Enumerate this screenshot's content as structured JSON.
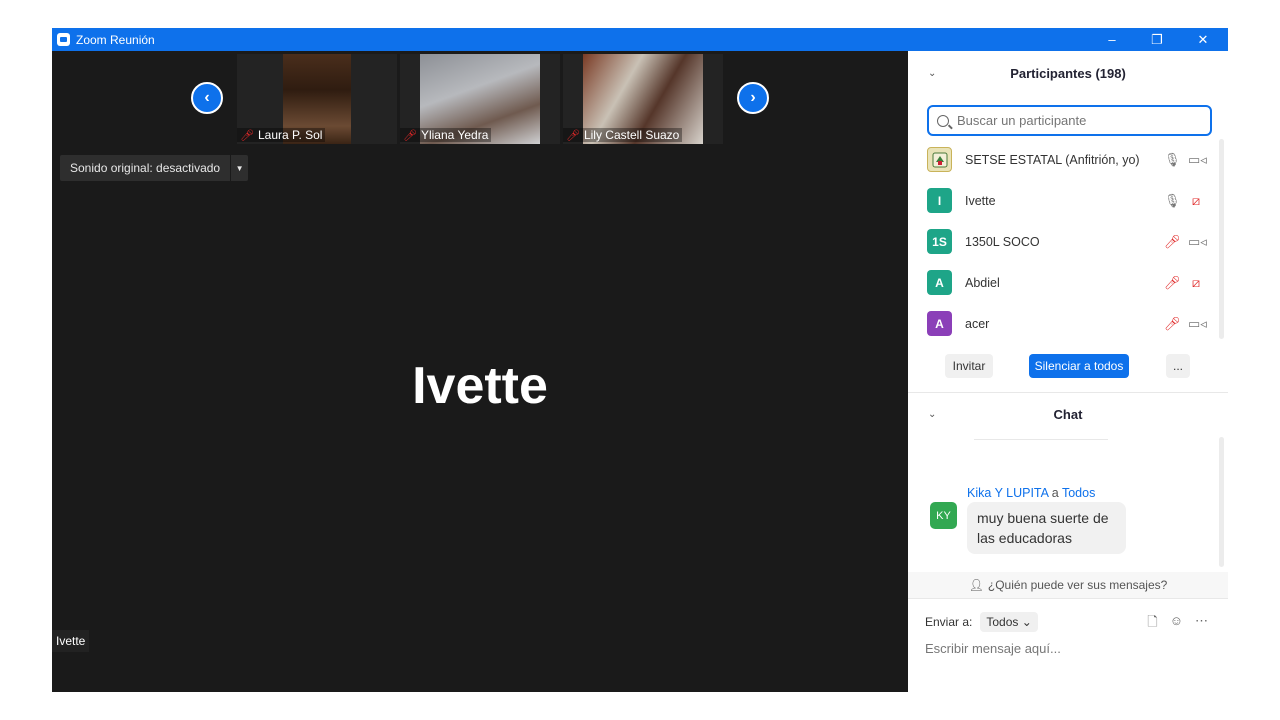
{
  "window": {
    "title": "Zoom Reunión",
    "min": "–",
    "max": "❐",
    "close": "✕"
  },
  "thumbs": [
    {
      "name": "Laura P. Sol"
    },
    {
      "name": "Yliana Yedra"
    },
    {
      "name": "Lily Castell Suazo"
    }
  ],
  "nav": {
    "prev": "‹",
    "next": "›"
  },
  "sound": {
    "label": "Sonido original: desactivado",
    "caret": "▼"
  },
  "speaker": {
    "big_name": "Ivette",
    "tag": "Ivette"
  },
  "participants": {
    "header": "Participantes (198)",
    "search_placeholder": "Buscar un participante",
    "items": [
      {
        "initials": "",
        "name": "SETSE ESTATAL (Anfitrión, yo)",
        "color": "#e9e3b8",
        "mic": "on",
        "cam": "on"
      },
      {
        "initials": "I",
        "name": "Ivette",
        "color": "#1ea588",
        "mic": "on",
        "cam": "off"
      },
      {
        "initials": "1S",
        "name": "1350L SOCO",
        "color": "#1ea588",
        "mic": "off",
        "cam": "on"
      },
      {
        "initials": "A",
        "name": "Abdiel",
        "color": "#1ea588",
        "mic": "off",
        "cam": "off"
      },
      {
        "initials": "A",
        "name": "acer",
        "color": "#8b3fb8",
        "mic": "off",
        "cam": "on"
      }
    ],
    "invite": "Invitar",
    "mute_all": "Silenciar a todos",
    "more": "..."
  },
  "chat": {
    "header": "Chat",
    "sender": "Kika Y LUPITA",
    "to_word": "a",
    "recipient": "Todos",
    "avatar": "KY",
    "message": "muy buena suerte de las educadoras",
    "who_sees": "¿Quién puede ver sus mensajes?",
    "send_to_label": "Enviar a:",
    "send_to_value": "Todos",
    "input_placeholder": "Escribir mensaje aquí..."
  }
}
